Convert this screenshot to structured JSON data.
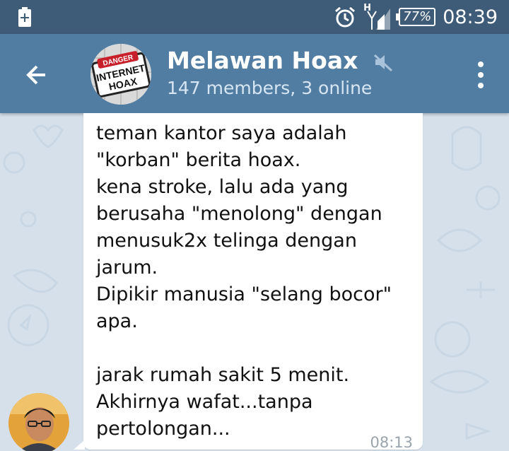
{
  "status_bar": {
    "network": "H",
    "battery": "77%",
    "time": "08:39"
  },
  "header": {
    "title": "Melawan Hoax",
    "subtitle": "147 members, 3 online",
    "avatar_text": [
      "DANGER",
      "INTERNET",
      "HOAX"
    ]
  },
  "message": {
    "text": "teman kantor saya adalah\n\"korban\" berita hoax.\nkena stroke, lalu ada yang\nberusaha \"menolong\" dengan\nmenusuk2x telinga dengan\njarum.\nDipikir manusia \"selang bocor\"\napa.\n\njarak rumah sakit 5 menit.\nAkhirnya wafat...tanpa\npertolongan...",
    "time": "08:13"
  },
  "colors": {
    "status_bar": "#3e5b78",
    "app_bar": "#527da3",
    "chat_background": "#d5e0ea",
    "bubble": "#ffffff"
  },
  "icons": {
    "back": "arrow-left",
    "mute": "speaker-off",
    "more": "vertical-dots",
    "alarm": "alarm-clock",
    "signal": "cell-signal",
    "notification": "plus-square"
  }
}
